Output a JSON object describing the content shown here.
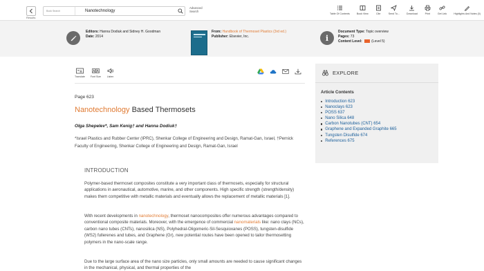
{
  "toolbar": {
    "results_label": "Results",
    "search_scope": "Book Search",
    "search_value": "Nanotechnology",
    "advanced_search_line1": "Advanced",
    "advanced_search_line2": "Search",
    "tools": [
      {
        "label": "Table Of Contents",
        "icon": "list-icon"
      },
      {
        "label": "Book View",
        "icon": "book-view-icon"
      },
      {
        "label": "Cite",
        "icon": "cite-icon"
      },
      {
        "label": "Send To...",
        "icon": "send-icon"
      },
      {
        "label": "Download",
        "icon": "download-icon"
      },
      {
        "label": "Print",
        "icon": "print-icon"
      },
      {
        "label": "Get Link",
        "icon": "link-icon"
      },
      {
        "label": "Highlights And Notes (0)",
        "icon": "highlight-pen-icon"
      }
    ]
  },
  "info": {
    "editors_label": "Editors:",
    "editors_value": "Hanna Dodiuk and Sidney H. Goodman",
    "date_label": "Date:",
    "date_value": "2014",
    "from_label": "From:",
    "from_value": "Handbook of Thermoset Plastics (3rd ed.)",
    "publisher_label": "Publisher:",
    "publisher_value": "Elsevier, Inc.",
    "doctype_label": "Document Type:",
    "doctype_value": "Topic overview",
    "pages_label": "Pages:",
    "pages_value": "73",
    "level_label": "Content Level:",
    "level_badge": "5",
    "level_value": "(Level 5)"
  },
  "article_tools": [
    {
      "label": "Translate",
      "icon": "translate-icon"
    },
    {
      "label": "Font Size",
      "icon": "font-size-icon"
    },
    {
      "label": "Listen",
      "icon": "listen-icon"
    }
  ],
  "article": {
    "page": "Page 623",
    "title_highlight": "Nanotechnology",
    "title_rest": " Based Thermosets",
    "authors": "Olga Shepelev*, Sam Kenig† and Hanna Dodiuk†",
    "affiliation": "*Israel Plastics and Rubber Center (IPRC), Shenkar College of Engineering and Design, Ramat-Gan, Israel, †Pernick Faculty of Engineering, Shenkar College of Engineering and Design, Ramat-Gan, Israel",
    "intro_heading": "INTRODUCTION",
    "para1": "Polymer-based thermoset composites constitute a very important class of thermosets, especially for structural applications in aeronautical, automotive, marine, and other components. High specific strength (strength/density) makes them competitive with metallic materials and eventually allows the replacement of metallic materials [1].",
    "para2_a": "With recent developments in ",
    "para2_hl1": "nanotechnology",
    "para2_b": ", thermoset nanocomposites offer numerous advantages compared to conventional composite materials. Moreover, with the emergence of commercial ",
    "para2_hl2": "nanomaterials",
    "para2_c": " like: nano clays (NCs), carbon nano tubes (CNTs), nanosilica (NS), Polyhedral-Oligomeric-Sil-Sesquioxanes (POSS), tungsten-disulfide (WS2) fullerenes and tubes, and Graphene (Gr), new potential routes have been opened to tailor thermosetting polymers in the nano-scale range.",
    "para3": "Due to the large surface area of the nano size particles, only small amounts are needed to cause significant changes in the mechanical, physical, and thermal properties of the"
  },
  "explore": {
    "heading": "EXPLORE",
    "contents_title": "Article Contents",
    "items": [
      "Introduction 623",
      "Nanoclays 623",
      "POSS 637",
      "Nano Silica 648",
      "Carbon Nanotubes (CNT) 654",
      "Graphene and Expanded Graphite 665",
      "Tungsten Disulfide 674",
      "References 675"
    ]
  },
  "colors": {
    "accent": "#e07a32",
    "link": "#1a5e9a",
    "panel_bg": "#f0f0f0",
    "band_bg": "#f3f3f3",
    "drive_blue": "#4285f4",
    "cloud_blue": "#1e74c6"
  }
}
